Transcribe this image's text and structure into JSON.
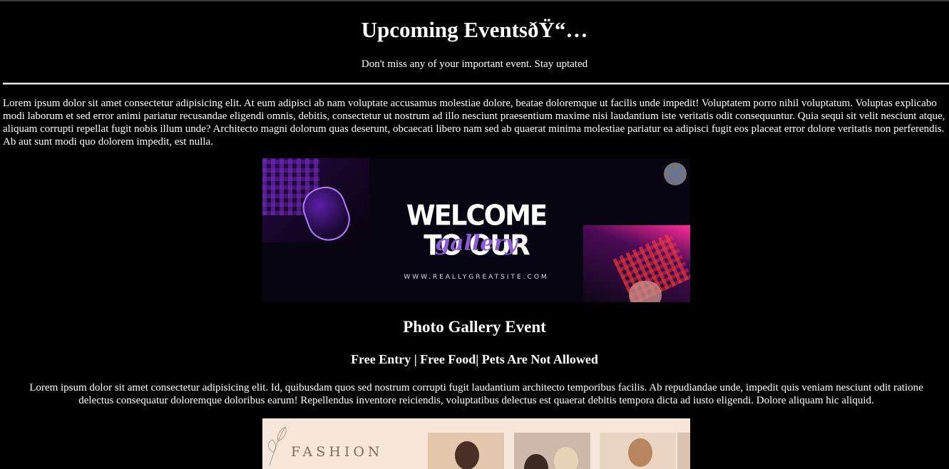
{
  "header": {
    "title": "Upcoming EventsðŸ“…",
    "subtitle": "Don't miss any of your important event. Stay uptated"
  },
  "intro": {
    "text": "Lorem ipsum dolor sit amet consectetur adipisicing elit. At eum adipisci ab nam voluptate accusamus molestiae dolore, beatae doloremque ut facilis unde impedit! Voluptatem porro nihil voluptatum. Voluptas explicabo modi laborum et sed error animi pariatur recusandae eligendi omnis, debitis, consectetur ut nostrum ad illo nesciunt praesentium maxime nisi laudantium iste veritatis odit consequuntur. Quia sequi sit velit nesciunt atque, aliquam corrupti repellat fugit nobis illum unde? Architecto magni dolorum quas deserunt, obcaecati libero nam sed ab quaerat minima molestiae pariatur ea adipisci fugit eos placeat error dolore veritatis non perferendis. Ab aut sunt modi quo dolorem impedit, est nulla."
  },
  "banner": {
    "headline": "WELCOME TO OUR",
    "script": "gallery",
    "site": "WWW.REALLYGREATSITE.COM",
    "lens_icon": "visual-search-icon",
    "colors": {
      "script": "#8e5ad9",
      "accent_pink": "#ff2d9a",
      "accent_purple": "#5b1fa8"
    }
  },
  "event": {
    "title": "Photo Gallery Event",
    "tags": "Free Entry | Free Food| Pets Are Not Allowed",
    "description": "Lorem ipsum dolor sit amet consectetur adipisicing elit. Id, quibusdam quos sed nostrum corrupti fugit laudantium architecto temporibus facilis. Ab repudiandae unde, impedit quis veniam nesciunt odit ratione delectus consequatur doloremque doloribus earum! Repellendus inventore reiciendis, voluptatibus delectus est quaerat debitis tempora dicta ad iusto eligendi. Dolore aliquam hic aliquid."
  },
  "fashion_poster": {
    "word": "FASHION"
  }
}
